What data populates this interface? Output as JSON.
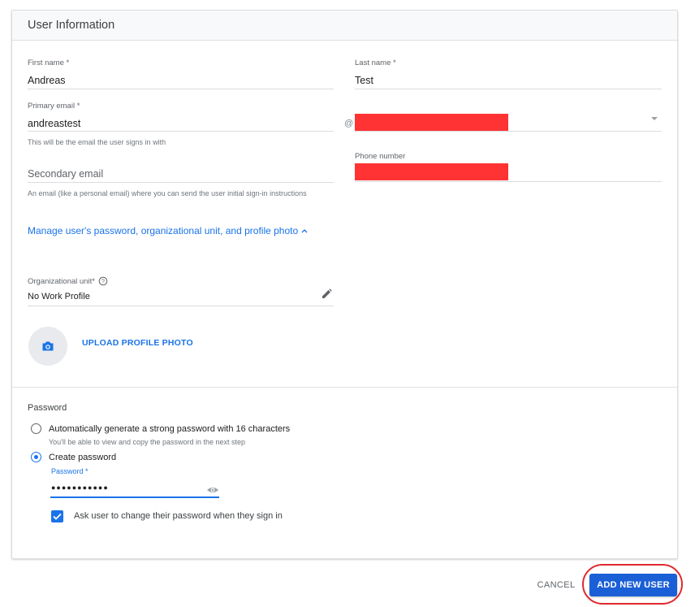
{
  "card": {
    "title": "User Information"
  },
  "fields": {
    "first_name": {
      "label": "First name *",
      "value": "Andreas"
    },
    "last_name": {
      "label": "Last name *",
      "value": "Test"
    },
    "primary_email": {
      "label": "Primary email *",
      "value": "andreastest",
      "at_symbol": "@",
      "hint": "This will be the email the user signs in with"
    },
    "phone": {
      "label": "Phone number"
    },
    "secondary_email": {
      "placeholder": "Secondary email",
      "hint": "An email (like a personal email) where you can send the user initial sign-in instructions"
    }
  },
  "manage_link": {
    "label": "Manage user's password, organizational unit, and profile photo"
  },
  "org_unit": {
    "label": "Organizational unit*",
    "value": "No Work Profile"
  },
  "upload_photo": {
    "label": "UPLOAD PROFILE PHOTO"
  },
  "password": {
    "section_title": "Password",
    "auto_option": {
      "label": "Automatically generate a strong password with 16 characters",
      "hint": "You'll be able to view and copy the password in the next step",
      "selected": false
    },
    "create_option": {
      "label": "Create password",
      "selected": true
    },
    "field_label": "Password *",
    "masked_value": "●●●●●●●●●●●",
    "ask_change": {
      "label": "Ask user to change their password when they sign in",
      "checked": true
    }
  },
  "actions": {
    "cancel": "CANCEL",
    "add": "ADD NEW USER"
  },
  "colors": {
    "accent": "#1a73e8",
    "primary_button": "#1a5fd6",
    "highlight": "#e0282f",
    "redaction": "#ff3333"
  },
  "icons": [
    "caret-up-icon",
    "help-circle-icon",
    "pencil-icon",
    "camera-icon",
    "dropdown-arrow-icon",
    "eye-icon",
    "check-icon"
  ]
}
